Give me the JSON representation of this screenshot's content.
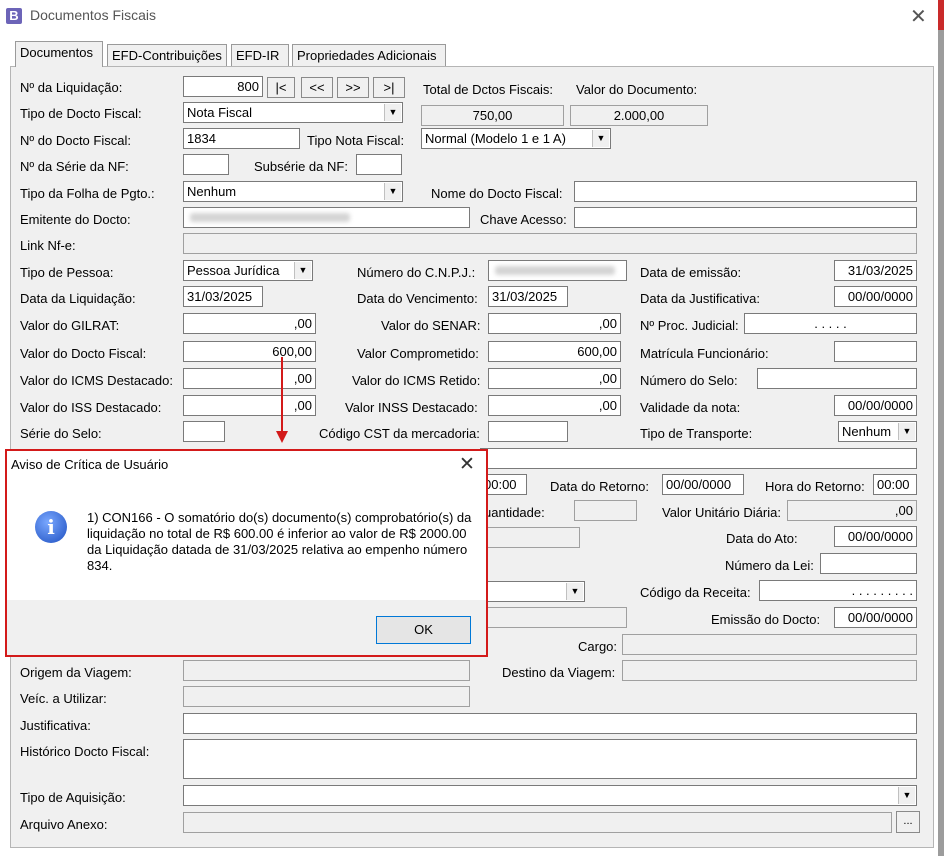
{
  "window": {
    "title": "Documentos Fiscais",
    "icon": "B"
  },
  "tabs": [
    "Documentos",
    "EFD-Contribuições",
    "EFD-IR",
    "Propriedades Adicionais"
  ],
  "nav_buttons": [
    "|<",
    "<<",
    ">>",
    ">|"
  ],
  "form": {
    "liquidacao_label": "Nº da Liquidação:",
    "liquidacao": "800",
    "total_label": "Total de Dctos Fiscais:",
    "total": "750,00",
    "valor_doc_label": "Valor do Documento:",
    "valor_doc": "2.000,00",
    "tipo_docto_label": "Tipo de Docto Fiscal:",
    "tipo_docto": "Nota Fiscal",
    "num_docto_label": "Nº do Docto Fiscal:",
    "num_docto": "1834",
    "tipo_nota_label": "Tipo Nota Fiscal:",
    "tipo_nota": "Normal (Modelo 1 e 1 A)",
    "serie_label": "Nº da Série da NF:",
    "serie": "",
    "subserie_label": "Subsérie da NF:",
    "subserie": "",
    "tipo_folha_label": "Tipo da Folha de Pgto.:",
    "tipo_folha": "Nenhum",
    "nome_docto_label": "Nome do Docto Fiscal:",
    "nome_docto": "",
    "emitente_label": "Emitente do Docto:",
    "chave_label": "Chave Acesso:",
    "chave": "",
    "link_label": "Link Nf-e:",
    "link": "",
    "tipo_pessoa_label": "Tipo de Pessoa:",
    "tipo_pessoa": "Pessoa Jurídica",
    "cnpj_label": "Número do  C.N.P.J.:",
    "data_emissao_label": "Data de emissão:",
    "data_emissao": "31/03/2025",
    "data_liq_label": "Data da Liquidação:",
    "data_liq": "31/03/2025",
    "data_venc_label": "Data do Vencimento:",
    "data_venc": "31/03/2025",
    "data_just_label": "Data da Justificativa:",
    "data_just": "00/00/0000",
    "gilrat_label": "Valor do GILRAT:",
    "gilrat": ",00",
    "senar_label": "Valor do SENAR:",
    "senar": ",00",
    "proc_label": "Nº Proc. Judicial:",
    "proc": ".     .   .  .  .",
    "valor_docto_label": "Valor do Docto Fiscal:",
    "valor_docto": "600,00",
    "comprometido_label": "Valor Comprometido:",
    "comprometido": "600,00",
    "matricula_label": "Matrícula Funcionário:",
    "matricula": "",
    "icms_dest_label": "Valor do ICMS Destacado:",
    "icms_dest": ",00",
    "icms_ret_label": "Valor do ICMS Retido:",
    "icms_ret": ",00",
    "num_selo_label": "Número do Selo:",
    "num_selo": "",
    "iss_label": "Valor do ISS Destacado:",
    "iss": ",00",
    "inss_label": "Valor INSS Destacado:",
    "inss": ",00",
    "validade_label": "Validade da nota:",
    "validade": "00/00/0000",
    "serie_selo_label": "Série do Selo:",
    "serie_selo": "",
    "cst_label": "Código CST da mercadoria:",
    "cst": "",
    "transporte_label": "Tipo de Transporte:",
    "transporte": "Nenhum",
    "hora_saida": "00:00",
    "data_retorno_label": "Data do Retorno:",
    "data_retorno": "00/00/0000",
    "hora_retorno_label": "Hora do Retorno:",
    "hora_retorno": "00:00",
    "quantidade_label": "uantidade:",
    "quantidade": "",
    "valor_unit_label": "Valor Unitário Diária:",
    "valor_unit": ",00",
    "data_ato_label": "Data do Ato:",
    "data_ato": "00/00/0000",
    "num_lei_label": "Número da Lei:",
    "num_lei": "",
    "cod_receita_label": "Código da Receita:",
    "cod_receita": ". . . . . .  . . .",
    "emissao_label": "Emissão do Docto:",
    "emissao": "00/00/0000",
    "cargo_label": "Cargo:",
    "cargo": "",
    "origem_label": "Origem da Viagem:",
    "origem": "",
    "destino_label": "Destino da Viagem:",
    "destino": "",
    "veic_label": "Veíc. a Utilizar:",
    "veic": "",
    "justificativa_label": "Justificativa:",
    "justificativa": "",
    "historico_label": "Histórico Docto Fiscal:",
    "historico": "",
    "aquisicao_label": "Tipo de Aquisição:",
    "aquisicao": "",
    "anexo_label": "Arquivo Anexo:",
    "anexo": "",
    "anexo_btn": "..."
  },
  "dialog": {
    "title": "Aviso de Crítica de Usuário",
    "icon": "i",
    "message": "1) CON166 - O somatório do(s) documento(s) comprobatório(s) da liquidação no total de R$ 600.00 é inferior ao valor de R$ 2000.00 da Liquidação datada de 31/03/2025 relativa ao empenho número 834.",
    "ok": "OK"
  },
  "colors": {
    "highlight": "#d31a1a",
    "info_icon": "#1d4fc0"
  }
}
